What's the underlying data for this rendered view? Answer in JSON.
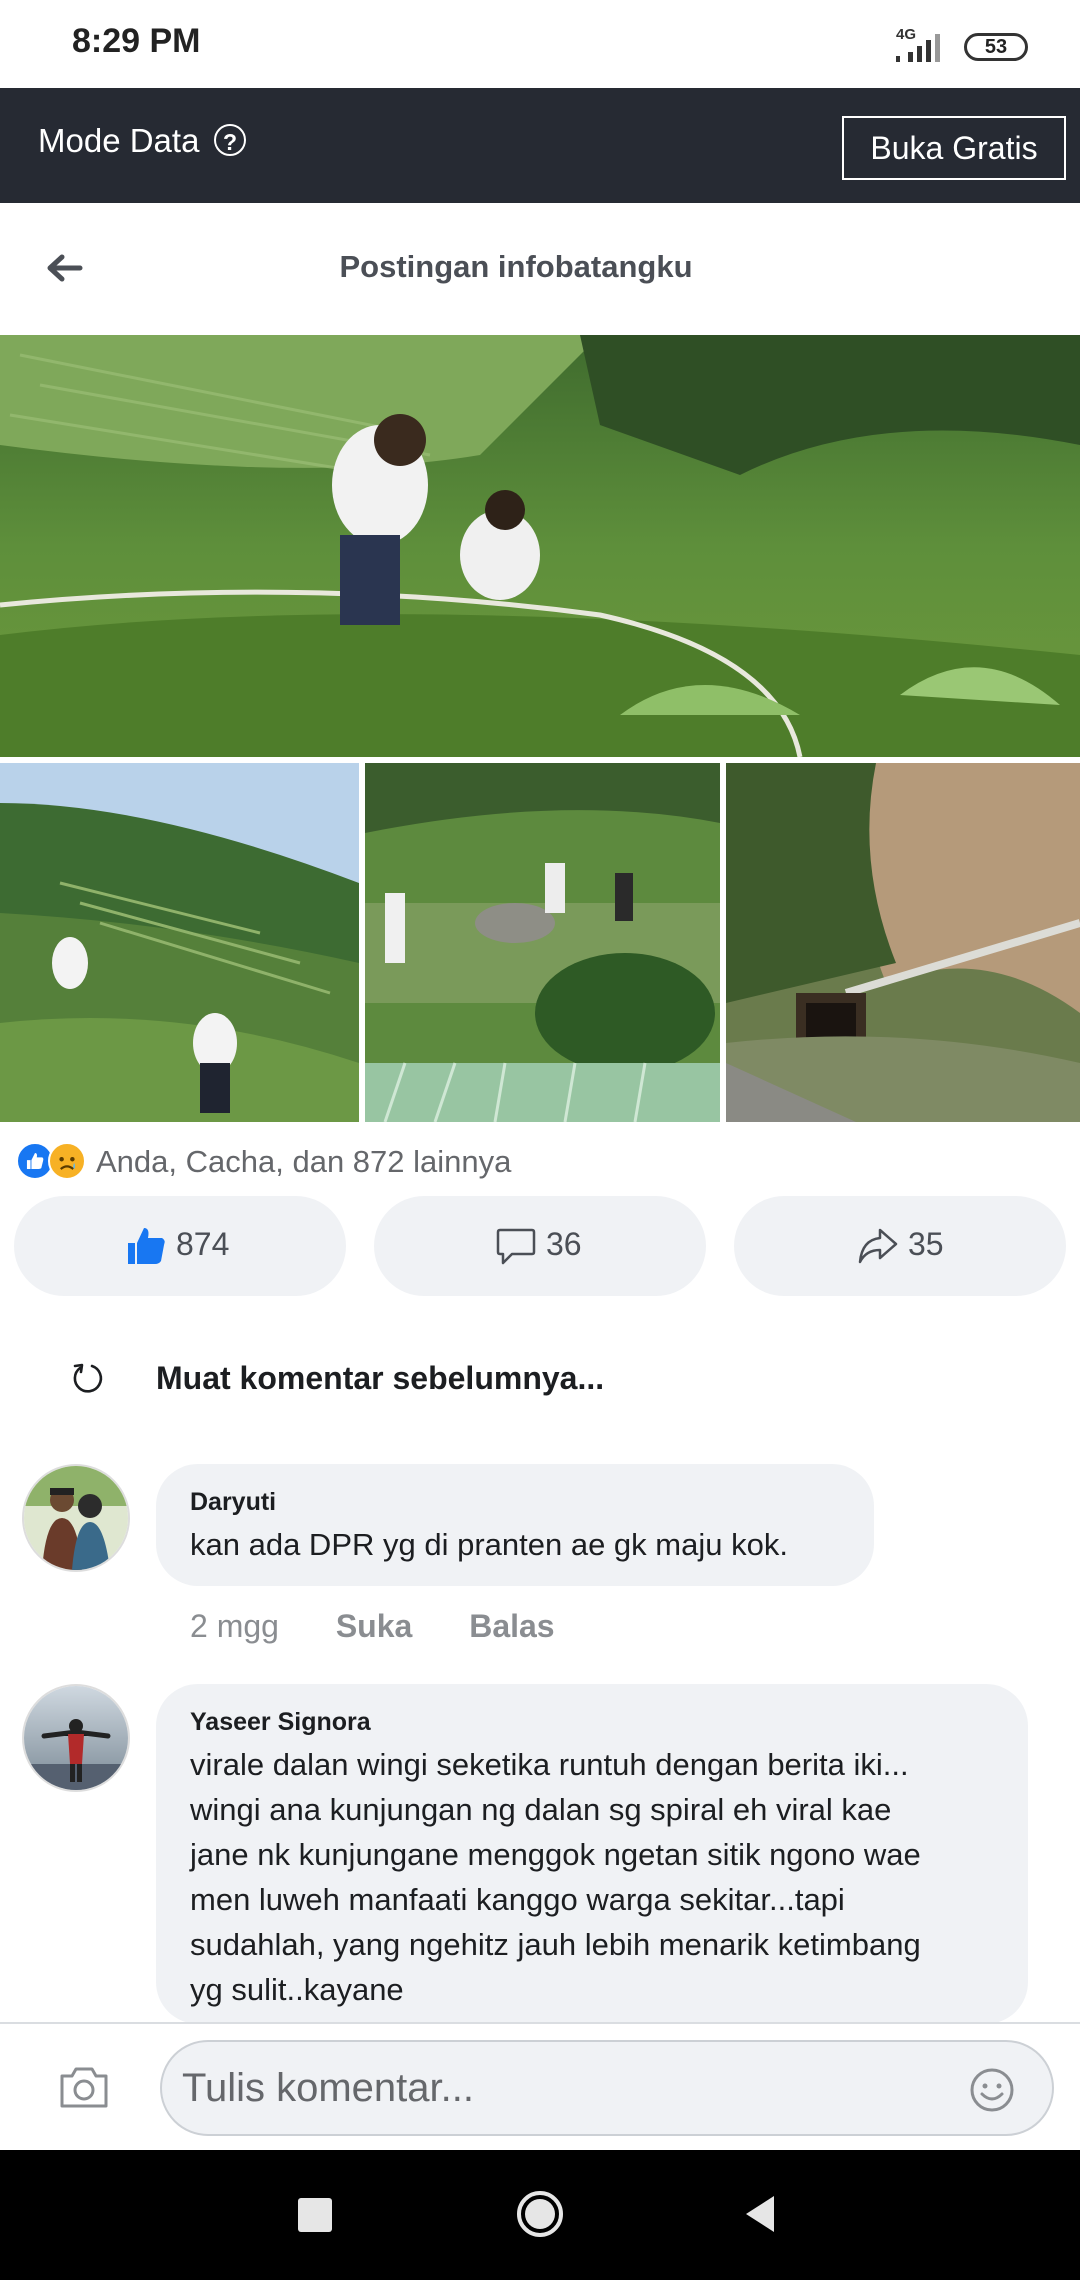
{
  "status_bar": {
    "time": "8:29 PM",
    "network": "4G",
    "battery": "53"
  },
  "data_banner": {
    "mode_label": "Mode Data",
    "help_symbol": "?",
    "free_button": "Buka Gratis"
  },
  "header": {
    "title": "Postingan infobatangku"
  },
  "post": {
    "photos": [
      {
        "description": "terraced farm hillside"
      },
      {
        "description": "hillside field"
      },
      {
        "description": "group in field"
      },
      {
        "description": "cliff and tunnel"
      }
    ],
    "reactions": {
      "text": "Anda, Cacha, dan 872 lainnya",
      "like_count": "874",
      "comment_count": "36",
      "share_count": "35"
    }
  },
  "comments": {
    "load_previous": "Muat komentar sebelumnya...",
    "items": [
      {
        "name": "Daryuti",
        "text": "kan ada DPR  yg di pranten ae gk maju kok.",
        "time": "2 mgg",
        "like_label": "Suka",
        "reply_label": "Balas"
      },
      {
        "name": "Yaseer Signora",
        "lines": [
          "virale dalan wingi seketika runtuh dengan berita iki...",
          "wingi ana kunjungan ng dalan sg spiral eh viral kae",
          "jane nk kunjungane menggok ngetan sitik ngono wae",
          "men luweh manfaati kanggo warga sekitar...tapi",
          "sudahlah, yang ngehitz jauh lebih menarik ketimbang",
          "yg sulit..kayane"
        ]
      }
    ]
  },
  "composer": {
    "placeholder": "Tulis komentar..."
  },
  "colors": {
    "facebook_blue": "#1877f2",
    "banner_bg": "#262a33",
    "bubble_bg": "#f0f2f5"
  }
}
